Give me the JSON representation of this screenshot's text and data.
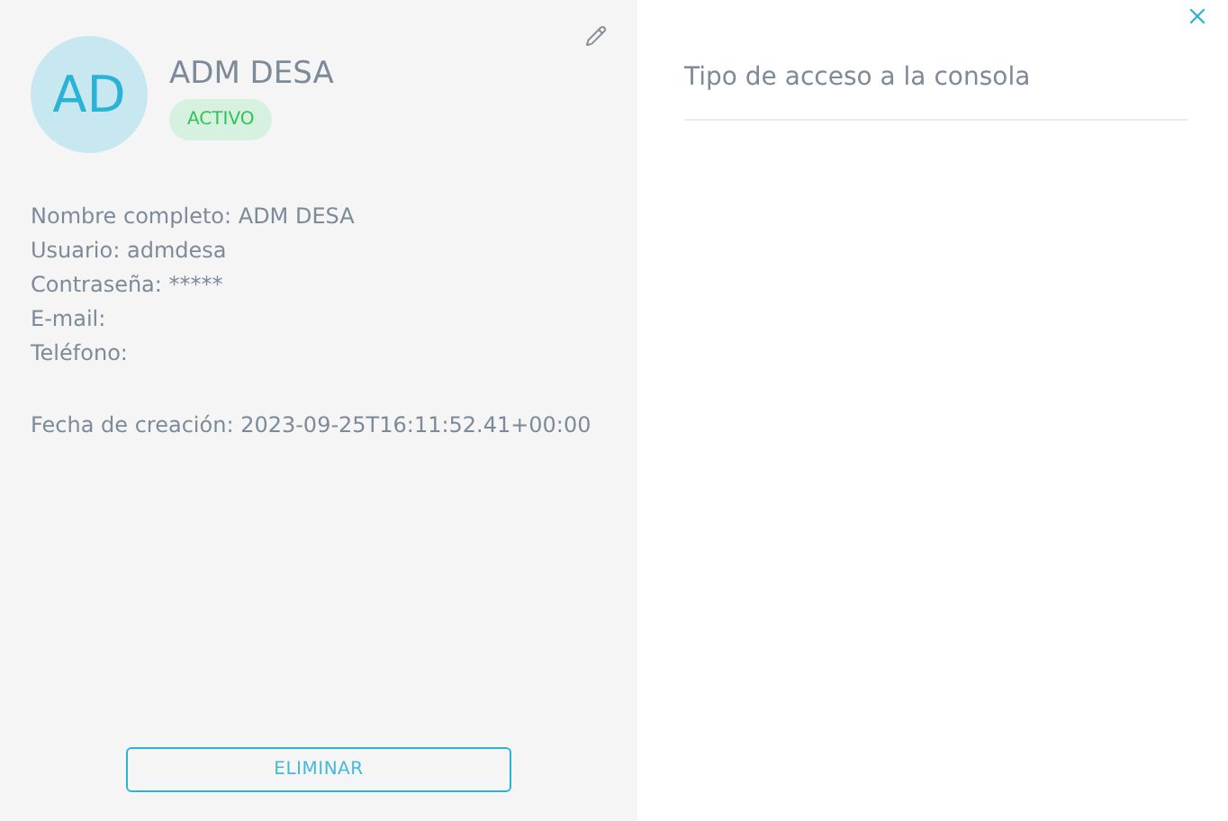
{
  "user": {
    "initials": "AD",
    "name": "ADM DESA",
    "status": {
      "label": "ACTIVO",
      "active": true
    }
  },
  "fields": [
    {
      "label": "Nombre completo:",
      "value": "ADM DESA"
    },
    {
      "label": "Usuario:",
      "value": "admdesa"
    },
    {
      "label": "Contraseña:",
      "value": "*****"
    },
    {
      "label": "E-mail:"
    },
    {
      "label": "Teléfono:"
    }
  ],
  "created": {
    "label": "Fecha de creación:",
    "value": "2023-09-25T16:11:52.41+00:00"
  },
  "delete_button": "ELIMINAR",
  "access_panel": {
    "title": "Tipo de acceso a la consola"
  }
}
